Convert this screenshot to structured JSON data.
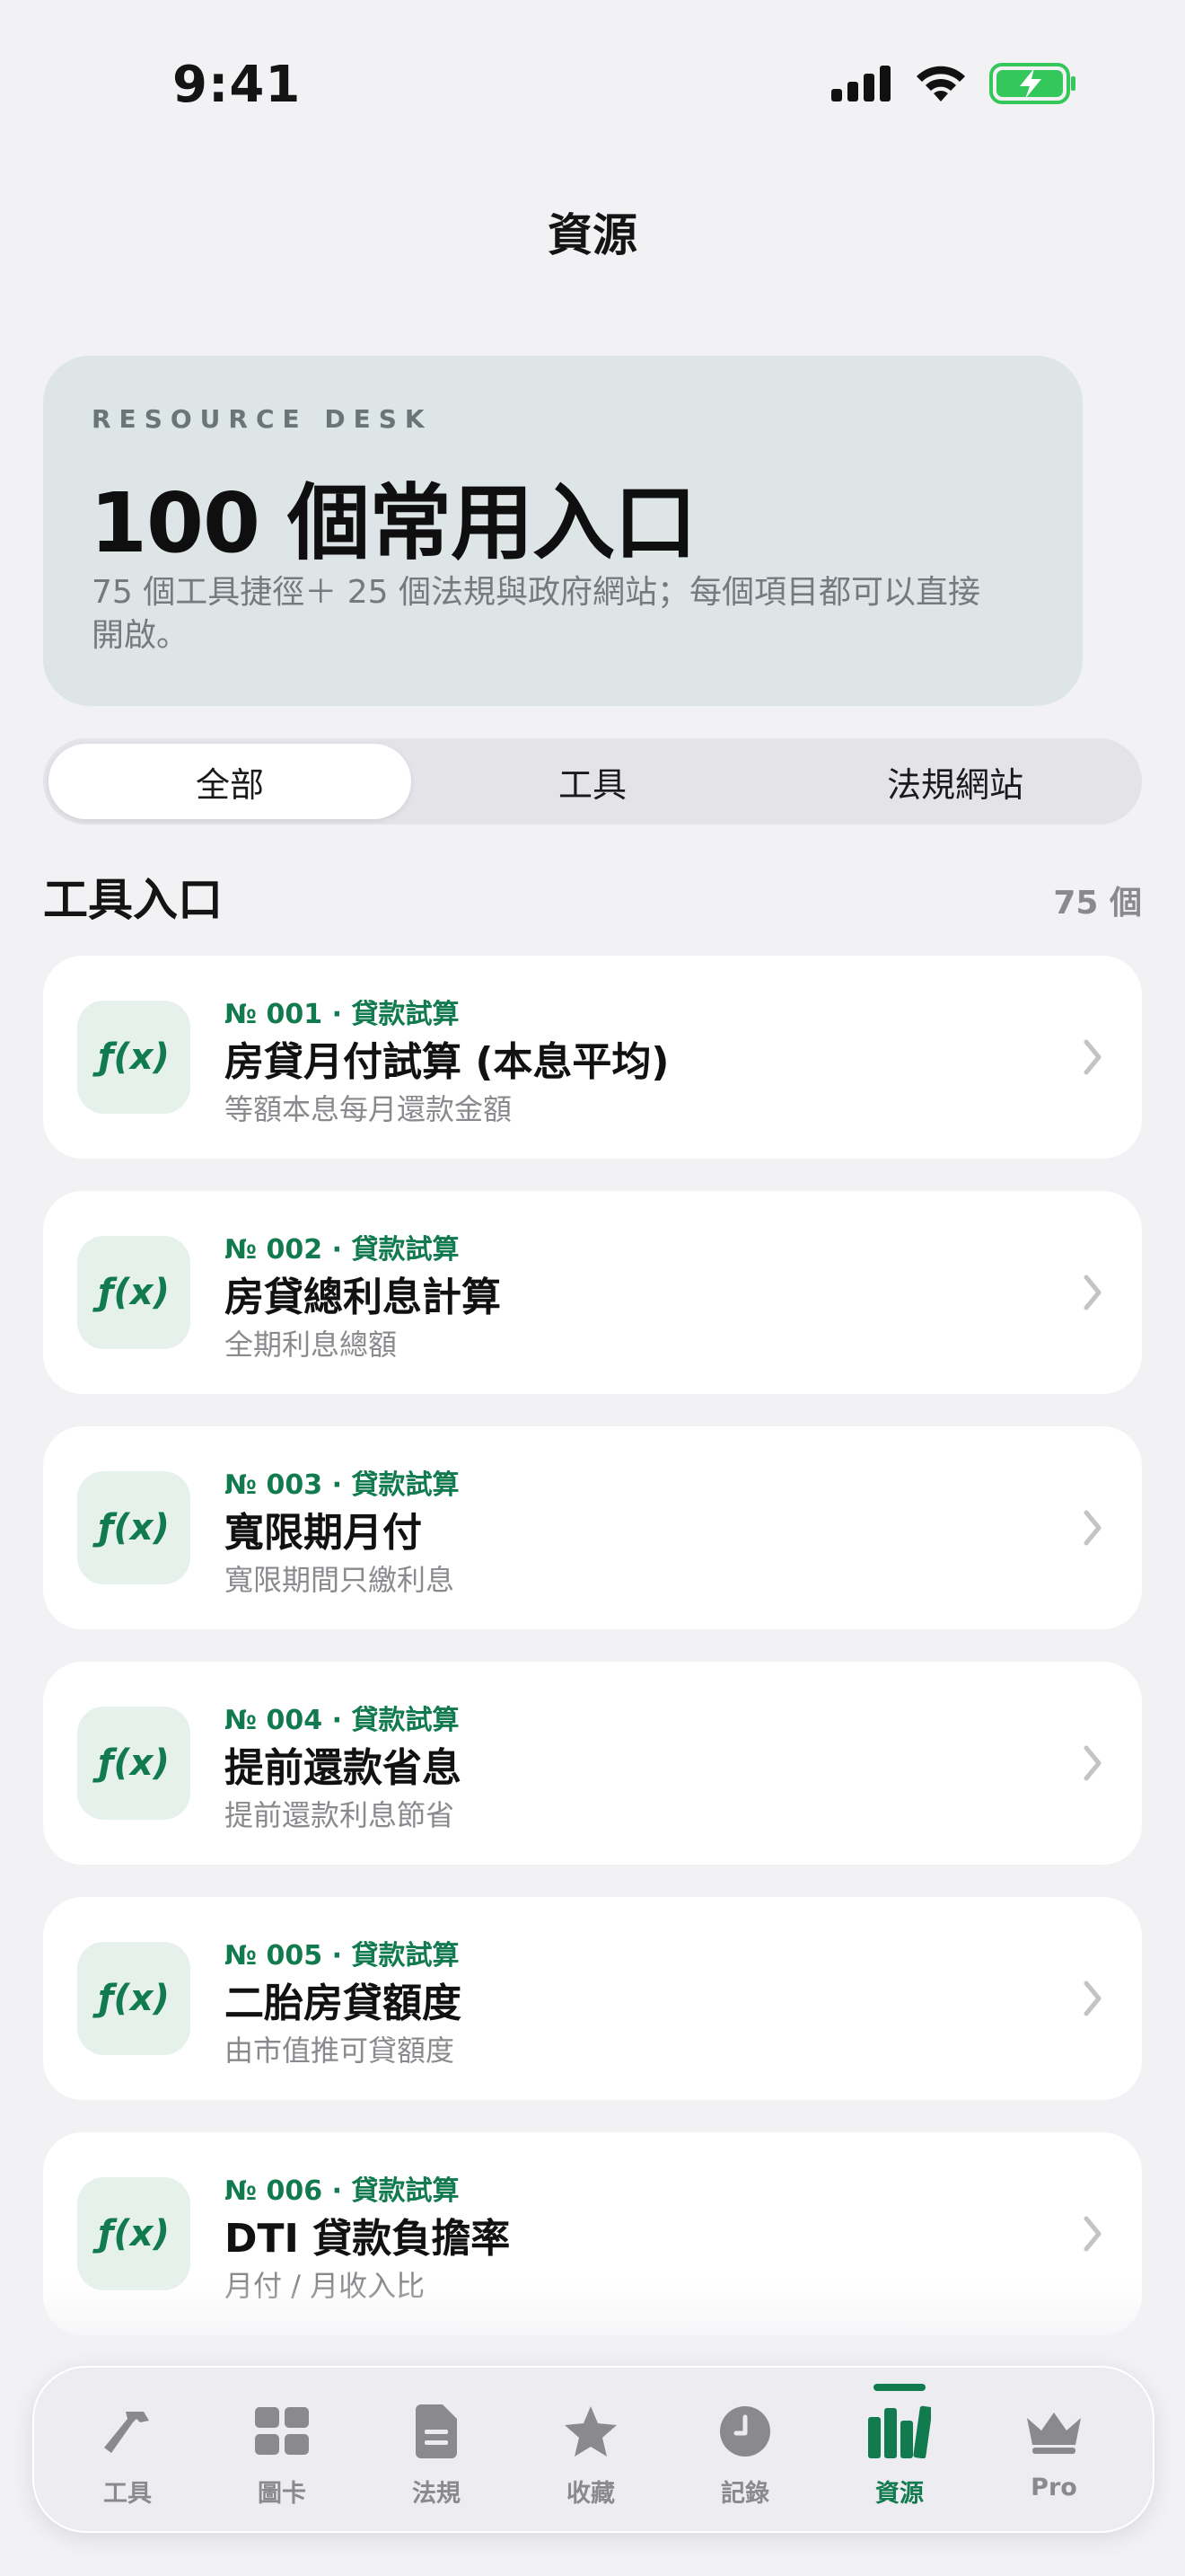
{
  "status_bar": {
    "time": "9:41"
  },
  "nav": {
    "title": "資源"
  },
  "hero": {
    "kicker": "RESOURCE DESK",
    "title": "100 個常用入口",
    "description": "75 個工具捷徑＋ 25 個法規與政府網站；每個項目都可以直接開啟。"
  },
  "segments": [
    {
      "label": "全部",
      "selected": true
    },
    {
      "label": "工具",
      "selected": false
    },
    {
      "label": "法規網站",
      "selected": false
    }
  ],
  "section": {
    "title": "工具入口",
    "count": "75 個"
  },
  "items": [
    {
      "icon": "function-icon",
      "icon_text": "ƒ(x)",
      "meta": "№ 001 · 貸款試算",
      "title": "房貸月付試算 (本息平均)",
      "subtitle": "等額本息每月還款金額"
    },
    {
      "icon": "function-icon",
      "icon_text": "ƒ(x)",
      "meta": "№ 002 · 貸款試算",
      "title": "房貸總利息計算",
      "subtitle": "全期利息總額"
    },
    {
      "icon": "function-icon",
      "icon_text": "ƒ(x)",
      "meta": "№ 003 · 貸款試算",
      "title": "寬限期月付",
      "subtitle": "寬限期間只繳利息"
    },
    {
      "icon": "function-icon",
      "icon_text": "ƒ(x)",
      "meta": "№ 004 · 貸款試算",
      "title": "提前還款省息",
      "subtitle": "提前還款利息節省"
    },
    {
      "icon": "function-icon",
      "icon_text": "ƒ(x)",
      "meta": "№ 005 · 貸款試算",
      "title": "二胎房貸額度",
      "subtitle": "由市值推可貸額度"
    },
    {
      "icon": "function-icon",
      "icon_text": "ƒ(x)",
      "meta": "№ 006 · 貸款試算",
      "title": "DTI 貸款負擔率",
      "subtitle": "月付 / 月收入比"
    }
  ],
  "tabbar": {
    "tabs": [
      {
        "label": "工具",
        "icon": "hammer-icon",
        "active": false
      },
      {
        "label": "圖卡",
        "icon": "grid-icon",
        "active": false
      },
      {
        "label": "法規",
        "icon": "document-icon",
        "active": false
      },
      {
        "label": "收藏",
        "icon": "star-icon",
        "active": false
      },
      {
        "label": "記錄",
        "icon": "clock-icon",
        "active": false
      },
      {
        "label": "資源",
        "icon": "books-icon",
        "active": true
      },
      {
        "label": "Pro",
        "icon": "crown-icon",
        "active": false
      }
    ]
  },
  "colors": {
    "accent": "#127a4f",
    "background": "#f2f2f5",
    "hero": "#dde5e7",
    "battery": "#34c759"
  }
}
